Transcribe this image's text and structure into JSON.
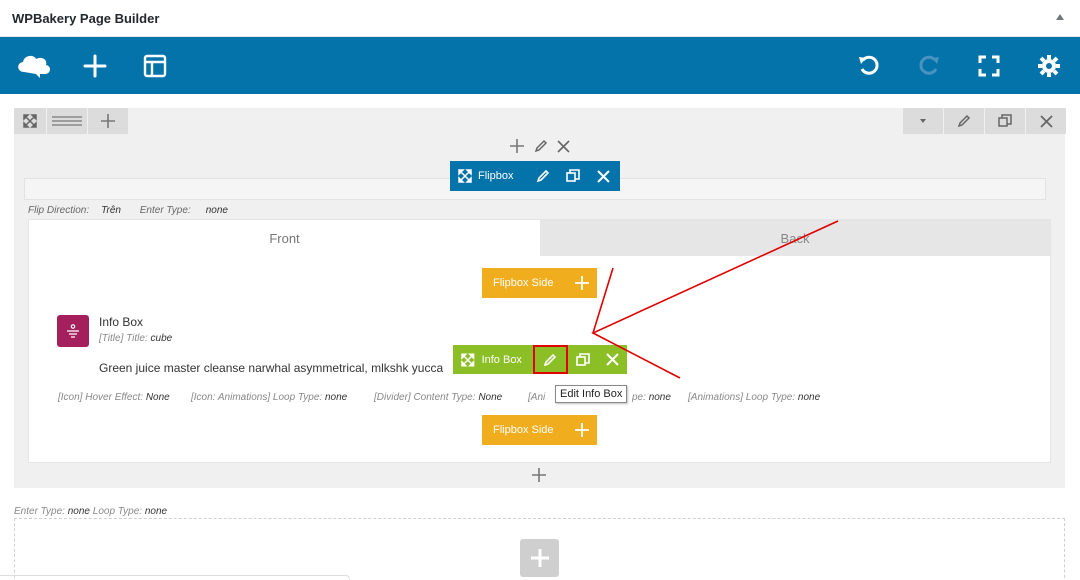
{
  "panel": {
    "title": "WPBakery Page Builder"
  },
  "toolbar": {
    "left_icons": [
      "wpbakery-logo-icon",
      "add-element-icon",
      "templates-icon"
    ],
    "right_icons": [
      "undo-icon",
      "redo-icon",
      "fullscreen-icon",
      "settings-icon"
    ],
    "color": "#0473aa"
  },
  "row": {
    "left_controls": [
      "row-expand-icon",
      "row-layout-icon",
      "row-add-icon"
    ],
    "right_controls": [
      "row-toggle-icon",
      "row-edit-icon",
      "row-clone-icon",
      "row-delete-icon"
    ]
  },
  "flipbox": {
    "label": "Flipbox",
    "meta": [
      {
        "key": "Flip Direction:",
        "value": "Trên"
      },
      {
        "key": "Enter Type:",
        "value": "none"
      }
    ],
    "tabs": {
      "front": "Front",
      "back": "Back"
    },
    "side_button": "Flipbox Side",
    "color": "#0473aa"
  },
  "infobox": {
    "title": "Info Box",
    "subtitle_key": "[Title] Title:",
    "subtitle_value": "cube",
    "text": "Green juice master cleanse narwhal asymmetrical, mlkshk yucca",
    "label": "Info Box",
    "tooltip": "Edit Info Box",
    "icon_color": "#a3205d",
    "bar_color": "#8cbf26",
    "meta": [
      {
        "key": "[Icon] Hover Effect:",
        "value": "None"
      },
      {
        "key": "[Icon: Animations] Loop Type:",
        "value": "none"
      },
      {
        "key": "[Divider] Content Type:",
        "value": "None"
      },
      {
        "key": "[Ani",
        "value": ""
      },
      {
        "key": "pe:",
        "value": "none"
      },
      {
        "key": "[Animations] Loop Type:",
        "value": "none"
      }
    ]
  },
  "row2": {
    "meta_key1": "Enter Type:",
    "meta_val1": "none",
    "meta_key2": "Loop Type:",
    "meta_val2": "none"
  },
  "accent": {
    "orange": "#f0ad1e",
    "annotation_red": "#e00000"
  }
}
